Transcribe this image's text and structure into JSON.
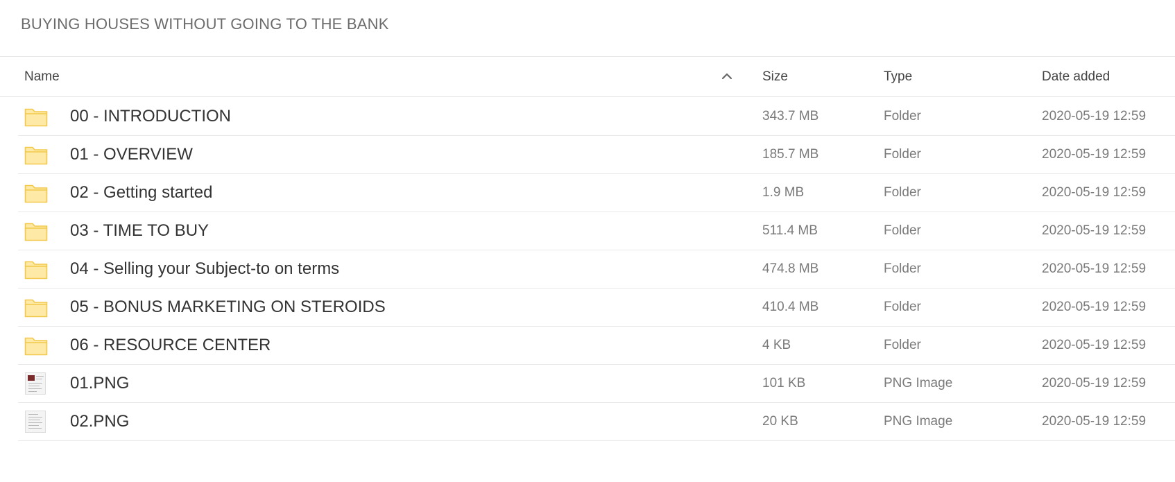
{
  "page": {
    "title": "BUYING HOUSES WITHOUT GOING TO THE BANK"
  },
  "header": {
    "name_label": "Name",
    "size_label": "Size",
    "type_label": "Type",
    "date_label": "Date added",
    "sort_icon": "chevron-up-icon"
  },
  "colors": {
    "folder_fill": "#FFE9A6",
    "folder_stroke": "#F2C94C",
    "divider": "#E8E8E8"
  },
  "files": [
    {
      "name": "00 - INTRODUCTION",
      "size": "343.7 MB",
      "type": "Folder",
      "date": "2020-05-19 12:59",
      "icon": "folder-icon"
    },
    {
      "name": "01 - OVERVIEW",
      "size": "185.7 MB",
      "type": "Folder",
      "date": "2020-05-19 12:59",
      "icon": "folder-icon"
    },
    {
      "name": "02 - Getting started",
      "size": "1.9 MB",
      "type": "Folder",
      "date": "2020-05-19 12:59",
      "icon": "folder-icon"
    },
    {
      "name": "03 - TIME TO BUY",
      "size": "511.4 MB",
      "type": "Folder",
      "date": "2020-05-19 12:59",
      "icon": "folder-icon"
    },
    {
      "name": "04 - Selling your Subject-to on terms",
      "size": "474.8 MB",
      "type": "Folder",
      "date": "2020-05-19 12:59",
      "icon": "folder-icon"
    },
    {
      "name": "05 - BONUS MARKETING ON STEROIDS",
      "size": "410.4 MB",
      "type": "Folder",
      "date": "2020-05-19 12:59",
      "icon": "folder-icon"
    },
    {
      "name": "06 - RESOURCE CENTER",
      "size": "4 KB",
      "type": "Folder",
      "date": "2020-05-19 12:59",
      "icon": "folder-icon"
    },
    {
      "name": "01.PNG",
      "size": "101 KB",
      "type": "PNG Image",
      "date": "2020-05-19 12:59",
      "icon": "image-thumbnail-icon"
    },
    {
      "name": "02.PNG",
      "size": "20 KB",
      "type": "PNG Image",
      "date": "2020-05-19 12:59",
      "icon": "image-thumbnail-icon"
    }
  ]
}
